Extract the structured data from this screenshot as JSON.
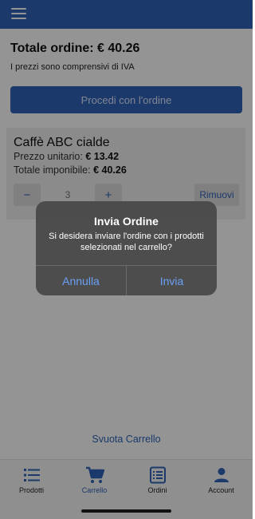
{
  "colors": {
    "brand": "#2f62b8",
    "dialog_action": "#6aa0f5",
    "overlay": "rgba(0,0,0,0.42)"
  },
  "header": {
    "menu_icon": "hamburger-menu-icon"
  },
  "order": {
    "total_label": "Totale ordine: € 40.26",
    "vat_note": "I prezzi sono comprensivi di IVA",
    "proceed_label": "Procedi con l'ordine"
  },
  "cart_item": {
    "name": "Caffè ABC cialde",
    "unit_price_label": "Prezzo unitario:",
    "unit_price_value": "€ 13.42",
    "taxable_label": "Totale imponibile:",
    "taxable_value": "€ 40.26",
    "minus_label": "−",
    "quantity": "3",
    "plus_label": "+",
    "remove_label": "Rimuovi"
  },
  "empty_cart_label": "Svuota Carrello",
  "bottom_nav": [
    {
      "label": "Prodotti",
      "icon": "list-icon",
      "active": false
    },
    {
      "label": "Carrello",
      "icon": "cart-icon",
      "active": true
    },
    {
      "label": "Ordini",
      "icon": "orders-icon",
      "active": false
    },
    {
      "label": "Account",
      "icon": "account-icon",
      "active": false
    }
  ],
  "dialog": {
    "title": "Invia Ordine",
    "message": "Si desidera inviare l'ordine con i prodotti selezionati nel carrello?",
    "cancel_label": "Annulla",
    "confirm_label": "Invia"
  }
}
